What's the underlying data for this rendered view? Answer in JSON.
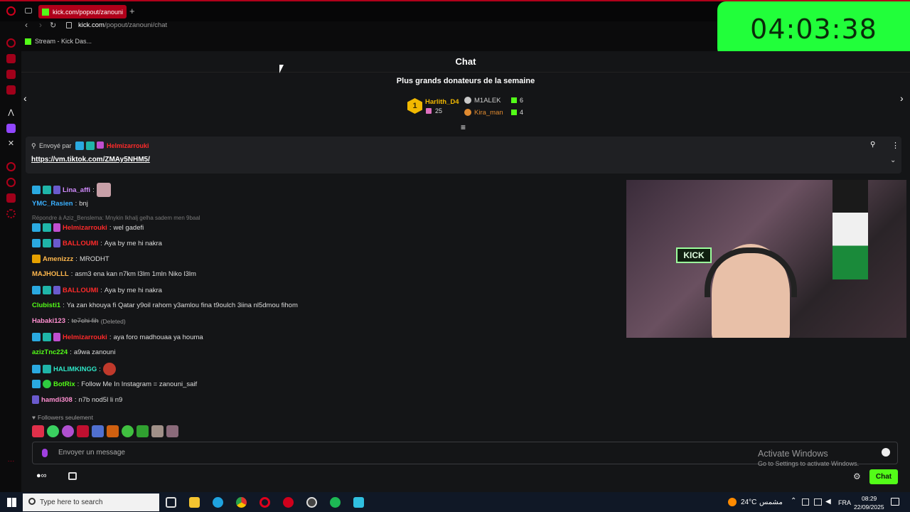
{
  "browser": {
    "tab_title": "kick.com/popout/zanouni",
    "new_tab": "+",
    "url_domain": "kick.com",
    "url_path": "/popout/zanouni/chat",
    "bookmark": "Stream - Kick Das..."
  },
  "timer": "04:03:38",
  "chat": {
    "title": "Chat",
    "donors_title": "Plus grands donateurs de la semaine",
    "donors": [
      {
        "rank": "1",
        "name": "Harlith_D4",
        "amount": "25"
      },
      {
        "name": "M1ALEK",
        "amount": "6"
      },
      {
        "name": "Kira_man",
        "amount": "4"
      }
    ],
    "pinned": {
      "sent_by_label": "Envoyé par",
      "sender": "Helmizarrouki",
      "link": "https://vm.tiktok.com/ZMAy5NHM5/"
    },
    "messages": [
      {
        "user": "Lina_affi",
        "text": "",
        "color": "#d38cff"
      },
      {
        "user": "YMC_Rasien",
        "text": "bnj",
        "color": "#3ab0ff"
      },
      {
        "reply": "Répondre à Aziz_Benslema: Mnykin lkhalj gelha sadem men 9baal"
      },
      {
        "user": "Helmizarrouki",
        "text": "wel gadefi",
        "color": "#ff2a2a"
      },
      {
        "user": "BALLOUMI",
        "text": "Aya by me hi nakra",
        "color": "#ff2a2a"
      },
      {
        "user": "Amenizzz",
        "text": "MRODHT",
        "color": "#ffb84d"
      },
      {
        "user": "MAJHOLLL",
        "text": "asm3 ena kan n7km l3lm 1mln Niko l3lm",
        "color": "#ffb84d"
      },
      {
        "user": "BALLOUMI",
        "text": "Aya by me hi nakra",
        "color": "#ff2a2a"
      },
      {
        "user": "Clubisti1",
        "text": "Ya zan khouya fi Qatar y9oil rahom y3amlou fina t9oulch 3iina nl5dmou fihom",
        "color": "#53fc18"
      },
      {
        "user": "Habaki123",
        "text": "te7chi fih",
        "deleted": "(Deleted)",
        "color": "#ff8fd0"
      },
      {
        "user": "Helmizarrouki",
        "text": "aya foro madhouaa ya houma",
        "color": "#ff2a2a"
      },
      {
        "user": "azizTnc224",
        "text": "a9wa zanouni",
        "color": "#53fc18"
      },
      {
        "user": "HALIMKINGG",
        "text": "",
        "color": "#2ee8c8"
      },
      {
        "user": "BotRix",
        "text": "Follow Me In Instagram = zanouni_saif",
        "color": "#53fc18"
      },
      {
        "user": "hamdi308",
        "text": "n7b nod5l li n9",
        "color": "#ff8fd0"
      }
    ],
    "followers_only": "Followers seulement",
    "input_placeholder": "Envoyer un message",
    "chat_button": "Chat"
  },
  "watermark": {
    "title": "Activate Windows",
    "subtitle": "Go to Settings to activate Windows."
  },
  "taskbar": {
    "search_placeholder": "Type here to search",
    "weather": "24°C",
    "weather_text": "مشمس",
    "lang": "FRA",
    "time": "08:29",
    "date": "22/09/2025"
  }
}
